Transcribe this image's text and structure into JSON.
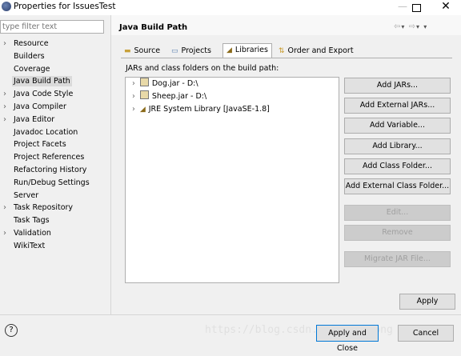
{
  "window": {
    "title": "Properties for IssuesTest",
    "close_glyph": "✕",
    "minimize_glyph": "—"
  },
  "sidebar": {
    "filter_placeholder": "type filter text",
    "items": [
      {
        "label": "Resource",
        "expandable": true
      },
      {
        "label": "Builders",
        "expandable": false
      },
      {
        "label": "Coverage",
        "expandable": false
      },
      {
        "label": "Java Build Path",
        "expandable": false,
        "selected": true
      },
      {
        "label": "Java Code Style",
        "expandable": true
      },
      {
        "label": "Java Compiler",
        "expandable": true
      },
      {
        "label": "Java Editor",
        "expandable": true
      },
      {
        "label": "Javadoc Location",
        "expandable": false
      },
      {
        "label": "Project Facets",
        "expandable": false
      },
      {
        "label": "Project References",
        "expandable": false
      },
      {
        "label": "Refactoring History",
        "expandable": false
      },
      {
        "label": "Run/Debug Settings",
        "expandable": false
      },
      {
        "label": "Server",
        "expandable": false
      },
      {
        "label": "Task Repository",
        "expandable": true
      },
      {
        "label": "Task Tags",
        "expandable": false
      },
      {
        "label": "Validation",
        "expandable": true
      },
      {
        "label": "WikiText",
        "expandable": false
      }
    ]
  },
  "page": {
    "title": "Java Build Path",
    "nav": {
      "back": "⇦",
      "forward": "⇨",
      "menu": "▾"
    },
    "tabs": [
      {
        "label": "Source",
        "icon": "source-folder-icon"
      },
      {
        "label": "Projects",
        "icon": "projects-icon"
      },
      {
        "label": "Libraries",
        "icon": "libraries-icon",
        "active": true
      },
      {
        "label": "Order and Export",
        "icon": "order-export-icon"
      }
    ],
    "description": "JARs and class folders on the build path:",
    "entries": [
      {
        "label": "Dog.jar - D:\\",
        "icon": "jar-icon"
      },
      {
        "label": "Sheep.jar - D:\\",
        "icon": "jar-icon"
      },
      {
        "label": "JRE System Library [JavaSE-1.8]",
        "icon": "library-icon"
      }
    ],
    "buttons": [
      {
        "label": "Add JARs...",
        "enabled": true
      },
      {
        "label": "Add External JARs...",
        "enabled": true
      },
      {
        "label": "Add Variable...",
        "enabled": true
      },
      {
        "label": "Add Library...",
        "enabled": true
      },
      {
        "label": "Add Class Folder...",
        "enabled": true
      },
      {
        "label": "Add External Class Folder...",
        "enabled": true
      },
      {
        "label": "Edit...",
        "enabled": false
      },
      {
        "label": "Remove",
        "enabled": false
      },
      {
        "label": "Migrate JAR File...",
        "enabled": false
      }
    ],
    "apply_label": "Apply"
  },
  "footer": {
    "help_glyph": "?",
    "watermark": "https://blog.csdn.net/shi_hong",
    "apply_close_label": "Apply and Close",
    "cancel_label": "Cancel"
  }
}
